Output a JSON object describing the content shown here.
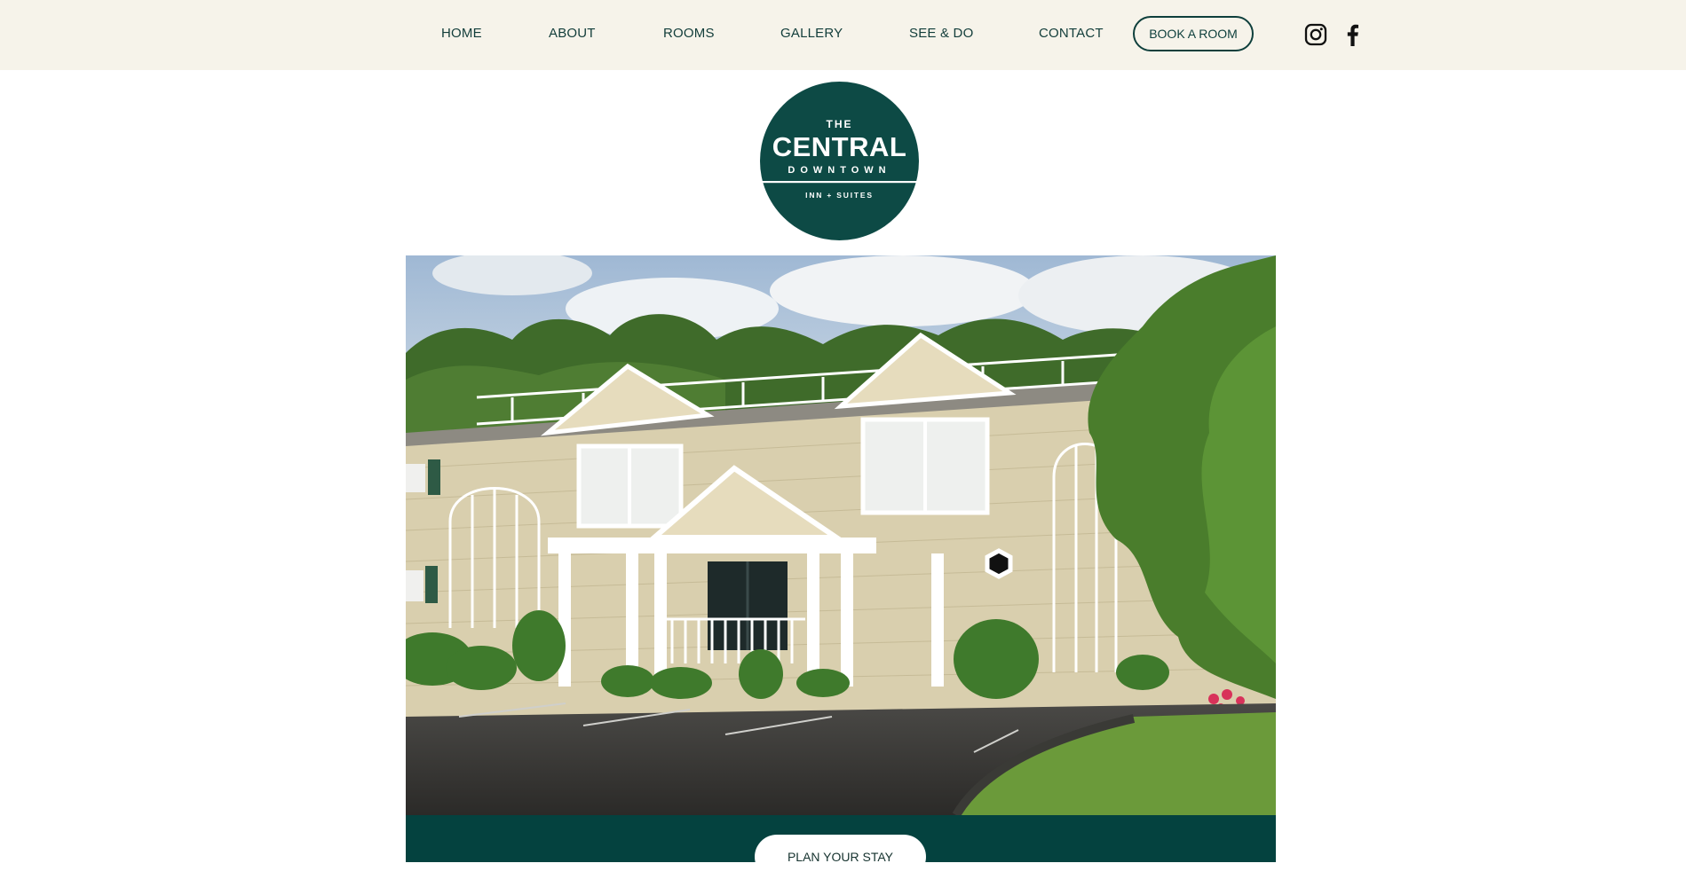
{
  "nav": {
    "items": [
      {
        "label": "HOME"
      },
      {
        "label": "ABOUT"
      },
      {
        "label": "ROOMS"
      },
      {
        "label": "GALLERY"
      },
      {
        "label": "SEE & DO"
      },
      {
        "label": "CONTACT"
      }
    ],
    "book_label": "BOOK A ROOM",
    "social": [
      {
        "icon": "instagram-icon"
      },
      {
        "icon": "facebook-icon"
      }
    ]
  },
  "logo": {
    "line1": "THE",
    "line2": "CENTRAL",
    "line3": "DOWNTOWN",
    "line4": "INN + SUITES"
  },
  "hero": {
    "image": "inn-building-photo"
  },
  "cta": {
    "label": "PLAN YOUR STAY"
  },
  "colors": {
    "brand_green": "#0d4a45",
    "band_green": "#04423f",
    "topbar_bg": "#f6f3ea",
    "nav_text": "#123d3a"
  }
}
